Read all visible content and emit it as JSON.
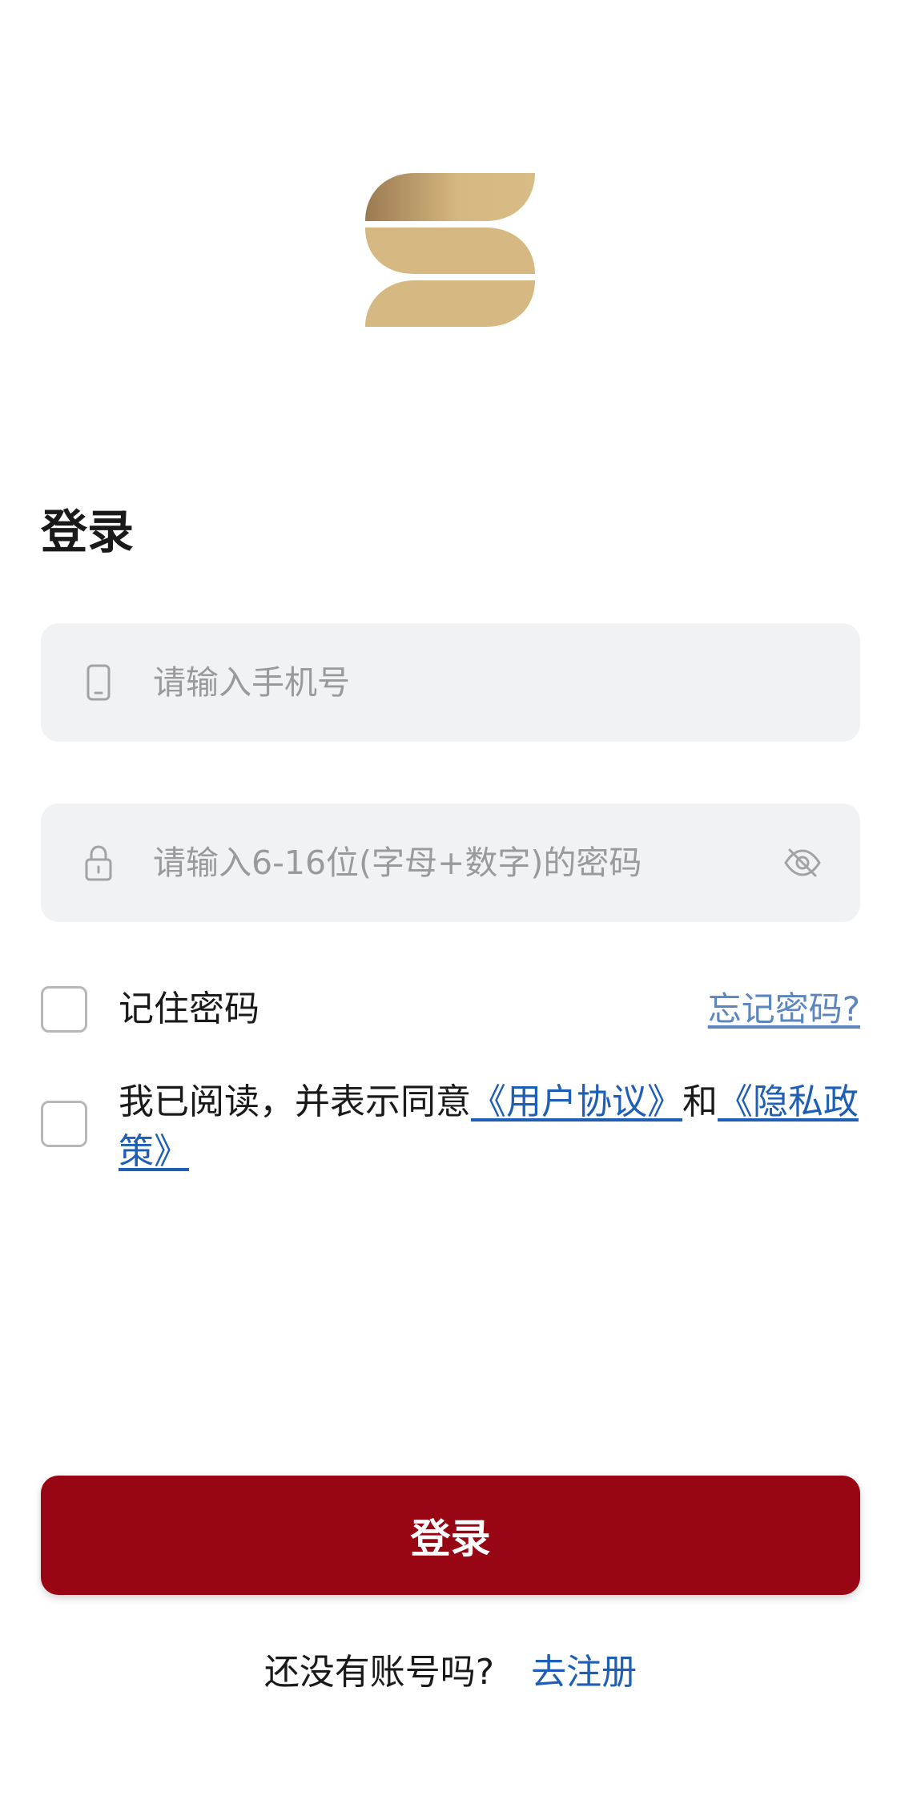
{
  "logo": {
    "icon": "brand-s-logo"
  },
  "page_title": "登录",
  "phone_field": {
    "icon": "phone-icon",
    "placeholder": "请输入手机号",
    "value": ""
  },
  "password_field": {
    "icon": "lock-icon",
    "placeholder": "请输入6-16位(字母+数字)的密码",
    "value": "",
    "toggle_icon": "eye-off-icon"
  },
  "remember": {
    "label": "记住密码",
    "checked": false
  },
  "forgot_link": "忘记密码?",
  "agreement": {
    "checked": false,
    "prefix": "我已阅读，并表示同意",
    "user_agreement": "《用户协议》",
    "conjunction": "和",
    "privacy_policy": "《隐私政策》"
  },
  "login_button": "登录",
  "signup": {
    "question": "还没有账号吗?",
    "link": "去注册"
  },
  "colors": {
    "primary_button": "#980613",
    "link_blue": "#1e5fb5",
    "logo_gold": "#d6b882"
  }
}
